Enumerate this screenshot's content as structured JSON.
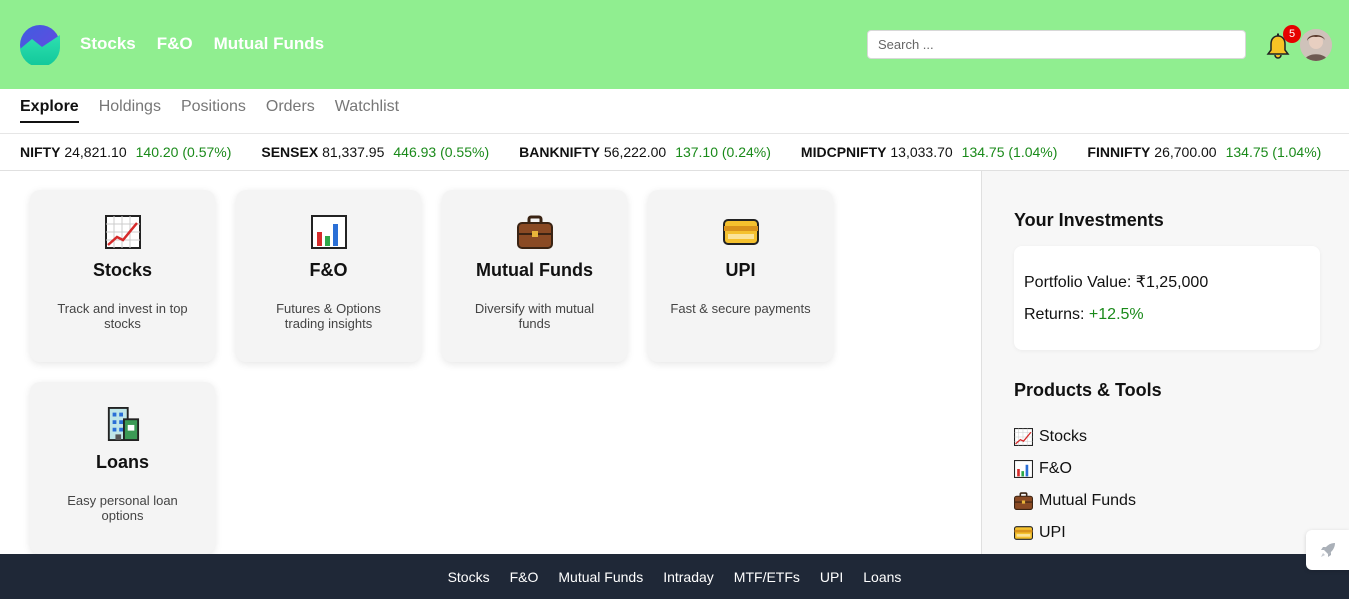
{
  "header": {
    "nav": [
      "Stocks",
      "F&O",
      "Mutual Funds"
    ],
    "search_placeholder": "Search ...",
    "notification_count": "5",
    "bg_color": "#90ee90"
  },
  "tabs": [
    "Explore",
    "Holdings",
    "Positions",
    "Orders",
    "Watchlist"
  ],
  "active_tab": "Explore",
  "ticker": [
    {
      "symbol": "NIFTY",
      "price": "24,821.10",
      "change": "140.20 (0.57%)"
    },
    {
      "symbol": "SENSEX",
      "price": "81,337.95",
      "change": "446.93 (0.55%)"
    },
    {
      "symbol": "BANKNIFTY",
      "price": "56,222.00",
      "change": "137.10 (0.24%)"
    },
    {
      "symbol": "MIDCPNIFTY",
      "price": "13,033.70",
      "change": "134.75 (1.04%)"
    },
    {
      "symbol": "FINNIFTY",
      "price": "26,700.00",
      "change": "134.75 (1.04%)"
    }
  ],
  "cards": [
    {
      "icon": "chart-up-icon",
      "title": "Stocks",
      "desc": "Track and invest in top stocks"
    },
    {
      "icon": "bar-chart-icon",
      "title": "F&O",
      "desc": "Futures & Options trading insights"
    },
    {
      "icon": "briefcase-icon",
      "title": "Mutual Funds",
      "desc": "Diversify with mutual funds"
    },
    {
      "icon": "credit-card-icon",
      "title": "UPI",
      "desc": "Fast & secure payments"
    },
    {
      "icon": "office-building-icon",
      "title": "Loans",
      "desc": "Easy personal loan options"
    }
  ],
  "sidebar": {
    "investments_title": "Your Investments",
    "portfolio_label": "Portfolio Value: ",
    "portfolio_value": "₹1,25,000",
    "returns_label": "Returns: ",
    "returns_value": "+12.5%",
    "tools_title": "Products & Tools",
    "tools": [
      {
        "icon": "chart-up-icon",
        "label": "Stocks"
      },
      {
        "icon": "bar-chart-icon",
        "label": "F&O"
      },
      {
        "icon": "briefcase-icon",
        "label": "Mutual Funds"
      },
      {
        "icon": "credit-card-icon",
        "label": "UPI"
      }
    ]
  },
  "footer": [
    "Stocks",
    "F&O",
    "Mutual Funds",
    "Intraday",
    "MTF/ETFs",
    "UPI",
    "Loans"
  ],
  "colors": {
    "positive": "#1a8a1a",
    "footer_bg": "#1f2837",
    "notification": "#e60000"
  }
}
